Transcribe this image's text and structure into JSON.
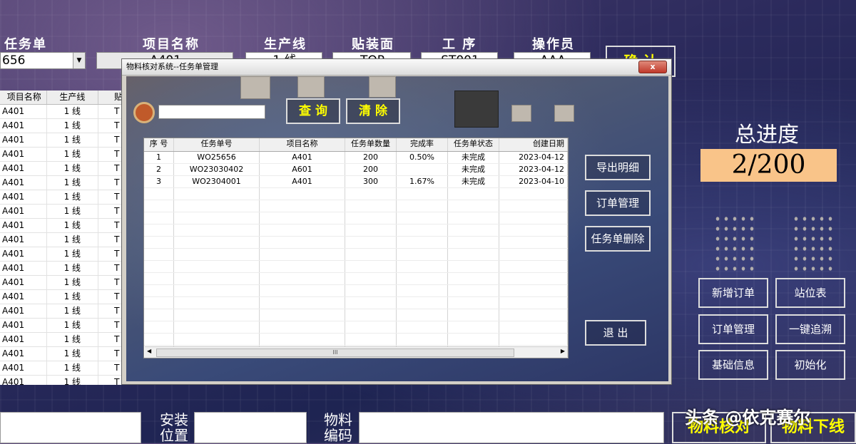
{
  "top_fields": {
    "task_label": "任务单",
    "task_value": "656",
    "project_label": "项目名称",
    "project_value": "A401",
    "line_label": "生产线",
    "line_value": "1 线",
    "side_label": "贴装面",
    "side_value": "TOP",
    "process_label": "工 序",
    "process_value": "ST001",
    "operator_label": "操作员",
    "operator_value": "AAA",
    "confirm_label": "确 认"
  },
  "bg_table": {
    "headers": [
      "项目名称",
      "生产线",
      "贴"
    ],
    "rows": [
      [
        "A401",
        "1 线",
        "T"
      ],
      [
        "A401",
        "1 线",
        "T"
      ],
      [
        "A401",
        "1 线",
        "T"
      ],
      [
        "A401",
        "1 线",
        "T"
      ],
      [
        "A401",
        "1 线",
        "T"
      ],
      [
        "A401",
        "1 线",
        "T"
      ],
      [
        "A401",
        "1 线",
        "T"
      ],
      [
        "A401",
        "1 线",
        "T"
      ],
      [
        "A401",
        "1 线",
        "T"
      ],
      [
        "A401",
        "1 线",
        "T"
      ],
      [
        "A401",
        "1 线",
        "T"
      ],
      [
        "A401",
        "1 线",
        "T"
      ],
      [
        "A401",
        "1 线",
        "T"
      ],
      [
        "A401",
        "1 线",
        "T"
      ],
      [
        "A401",
        "1 线",
        "T"
      ],
      [
        "A401",
        "1 线",
        "T"
      ],
      [
        "A401",
        "1 线",
        "T"
      ],
      [
        "A401",
        "1 线",
        "T"
      ],
      [
        "A401",
        "1 线",
        "T"
      ],
      [
        "A401",
        "1 线",
        "T"
      ],
      [
        "A401",
        "1 线",
        "T"
      ],
      [
        "A401",
        "1 线",
        "T"
      ]
    ]
  },
  "progress": {
    "title": "总进度",
    "value": "2/200"
  },
  "right_buttons": {
    "new_order": "新增订单",
    "station_table": "站位表",
    "order_mgmt": "订单管理",
    "trace": "一键追溯",
    "basic_info": "基础信息",
    "init": "初始化"
  },
  "bottom": {
    "install_pos_label": "安装位置",
    "material_code_label": "物料编码",
    "check_btn": "物料核对",
    "offline_btn": "物料下线"
  },
  "watermark": "头条 @依克赛尔",
  "dialog": {
    "title": "物料核对系统--任务单管理",
    "close_label": "x",
    "query_label": "查 询",
    "clear_label": "清 除",
    "export_label": "导出明细",
    "order_mgmt_label": "订单管理",
    "delete_label": "任务单删除",
    "exit_label": "退 出",
    "grid_headers": [
      "序 号",
      "任务单号",
      "项目名称",
      "任务单数量",
      "完成率",
      "任务单状态",
      "创建日期"
    ],
    "grid_rows": [
      [
        "1",
        "WO25656",
        "A401",
        "200",
        "0.50%",
        "未完成",
        "2023-04-12"
      ],
      [
        "2",
        "WO23030402",
        "A601",
        "200",
        "",
        "未完成",
        "2023-04-12"
      ],
      [
        "3",
        "WO2304001",
        "A401",
        "300",
        "1.67%",
        "未完成",
        "2023-04-10"
      ]
    ],
    "scroll_thumb": "III"
  }
}
